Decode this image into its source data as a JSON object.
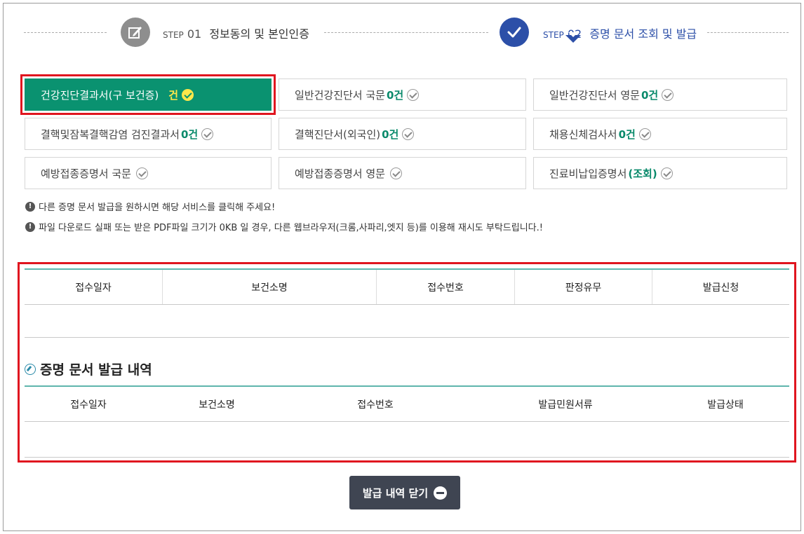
{
  "steps": [
    {
      "prefix": "STEP",
      "number": "01",
      "label": "정보동의 및 본인인증",
      "status": "done"
    },
    {
      "prefix": "STEP",
      "number": "02",
      "label": "증명 문서 조회 및 발급",
      "status": "current"
    }
  ],
  "services": [
    {
      "label": "건강진단결과서(구 보건증)",
      "count": "건",
      "active": true
    },
    {
      "label": "일반건강진단서 국문",
      "count": "0건"
    },
    {
      "label": "일반건강진단서 영문",
      "count": "0건"
    },
    {
      "label": "결핵및잠복결핵감염 검진결과서",
      "count": "0건"
    },
    {
      "label": "결핵진단서(외국인)",
      "count": "0건"
    },
    {
      "label": "채용신체검사서",
      "count": "0건"
    },
    {
      "label": "예방접종증명서 국문",
      "count": ""
    },
    {
      "label": "예방접종증명서 영문",
      "count": ""
    },
    {
      "label": "진료비납입증명서",
      "count": "(조회)"
    }
  ],
  "notices": [
    "다른 증명 문서 발급을 원하시면 해당 서비스를 클릭해 주세요!",
    "파일 다운로드 실패 또는 받은 PDF파일 크기가 0KB 일 경우, 다른 웹브라우저(크롬,사파리,엣지 등)를 이용해 재시도 부탁드립니다.!"
  ],
  "application_table": {
    "columns": [
      "접수일자",
      "보건소명",
      "접수번호",
      "판정유무",
      "발급신청"
    ],
    "rows": []
  },
  "history": {
    "title": "증명 문서 발급 내역",
    "columns": [
      "접수일자",
      "보건소명",
      "접수번호",
      "발급민원서류",
      "발급상태"
    ],
    "rows": []
  },
  "close_button": {
    "label": "발급 내역 닫기"
  },
  "colors": {
    "accent_green": "#0a9270",
    "step_blue": "#2c4fa8",
    "highlight_red": "#e0151f",
    "button_dark": "#3f4552"
  }
}
